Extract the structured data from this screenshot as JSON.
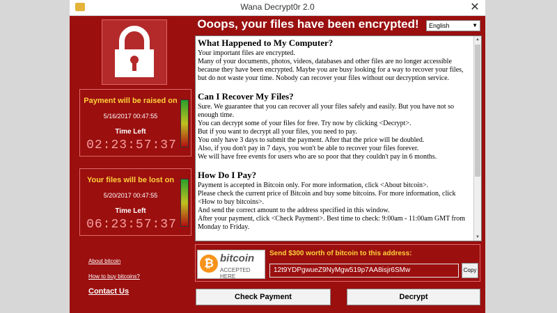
{
  "window": {
    "title": "Wana Decrypt0r 2.0",
    "close_glyph": "✕"
  },
  "header": {
    "headline": "Ooops, your files have been encrypted!",
    "language": "English"
  },
  "payment_raised": {
    "title": "Payment will be raised on",
    "date": "5/16/2017 00:47:55",
    "time_left_label": "Time Left",
    "timer": "02:23:57:37"
  },
  "files_lost": {
    "title": "Your files will be lost on",
    "date": "5/20/2017 00:47:55",
    "time_left_label": "Time Left",
    "timer": "06:23:57:37"
  },
  "links": {
    "about_bitcoin": "About bitcoin",
    "how_to_buy": "How to buy bitcoins?",
    "contact": "Contact Us"
  },
  "message": {
    "sections": [
      {
        "heading": "What Happened to My Computer?",
        "lines": [
          "Your important files are encrypted.",
          "Many of your documents, photos, videos, databases and other files are no longer accessible because they have been encrypted. Maybe you are busy looking for a way to recover your files, but do not waste your time. Nobody can recover your files without our decryption service."
        ]
      },
      {
        "heading": "Can I Recover My Files?",
        "lines": [
          "Sure. We guarantee that you can recover all your files safely and easily. But you have not so enough time.",
          "You can decrypt some of your files for free. Try now by clicking <Decrypt>.",
          "But if you want to decrypt all your files, you need to pay.",
          "You only have 3 days to submit the payment. After that the price will be doubled.",
          "Also, if you don't pay in 7 days, you won't be able to recover your files forever.",
          "We will have free events for users who are so poor that they couldn't pay in 6 months."
        ]
      },
      {
        "heading": "How Do I Pay?",
        "lines": [
          "Payment is accepted in Bitcoin only. For more information, click <About bitcoin>.",
          "Please check the current price of Bitcoin and buy some bitcoins. For more information, click <How to buy bitcoins>.",
          "And send the correct amount to the address specified in this window.",
          "After your payment, click <Check Payment>. Best time to check: 9:00am - 11:00am GMT from Monday to Friday."
        ]
      }
    ]
  },
  "payment": {
    "bitcoin_logo_word": "bitcoin",
    "bitcoin_logo_sub": "ACCEPTED HERE",
    "send_label": "Send $300 worth of bitcoin to this address:",
    "address": "12t9YDPgwueZ9NyMgw519p7AA8isjr6SMw",
    "copy_label": "Copy"
  },
  "buttons": {
    "check_payment": "Check Payment",
    "decrypt": "Decrypt"
  },
  "colors": {
    "window_bg": "#9b0f0f",
    "accent_yellow": "#ffd23a"
  }
}
